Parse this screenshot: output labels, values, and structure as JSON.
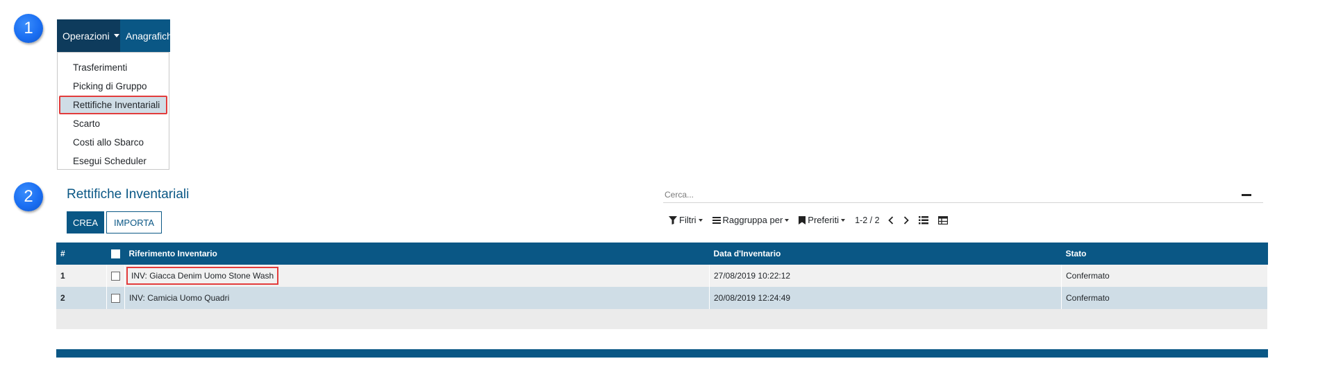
{
  "badges": {
    "one": "1",
    "two": "2"
  },
  "menu": {
    "operations_label": "Operazioni",
    "anagrafiche_label": "Anagrafiche",
    "items": [
      {
        "label": "Trasferimenti"
      },
      {
        "label": "Picking di Gruppo"
      },
      {
        "label": "Rettifiche Inventariali"
      },
      {
        "label": "Scarto"
      },
      {
        "label": "Costi allo Sbarco"
      },
      {
        "label": "Esegui Scheduler"
      }
    ]
  },
  "control_panel": {
    "title": "Rettifiche Inventariali",
    "create_label": "CREA",
    "import_label": "IMPORTA",
    "search_placeholder": "Cerca...",
    "filters_label": "Filtri",
    "groupby_label": "Raggruppa per",
    "favorites_label": "Preferiti",
    "pager": "1-2 / 2"
  },
  "table": {
    "headers": {
      "num": "#",
      "reference": "Riferimento Inventario",
      "date": "Data d'Inventario",
      "status": "Stato"
    },
    "rows": [
      {
        "num": "1",
        "reference": "INV: Giacca Denim Uomo Stone Wash",
        "date": "27/08/2019 10:22:12",
        "status": "Confermato"
      },
      {
        "num": "2",
        "reference": "INV: Camicia Uomo Quadri",
        "date": "20/08/2019 12:24:49",
        "status": "Confermato"
      }
    ]
  },
  "colors": {
    "primary": "#0a5785",
    "menu_dark": "#0e3b5c",
    "highlight": "#e23b3b",
    "selected_row": "#cfdde6",
    "badge": "#1a6ef2"
  }
}
